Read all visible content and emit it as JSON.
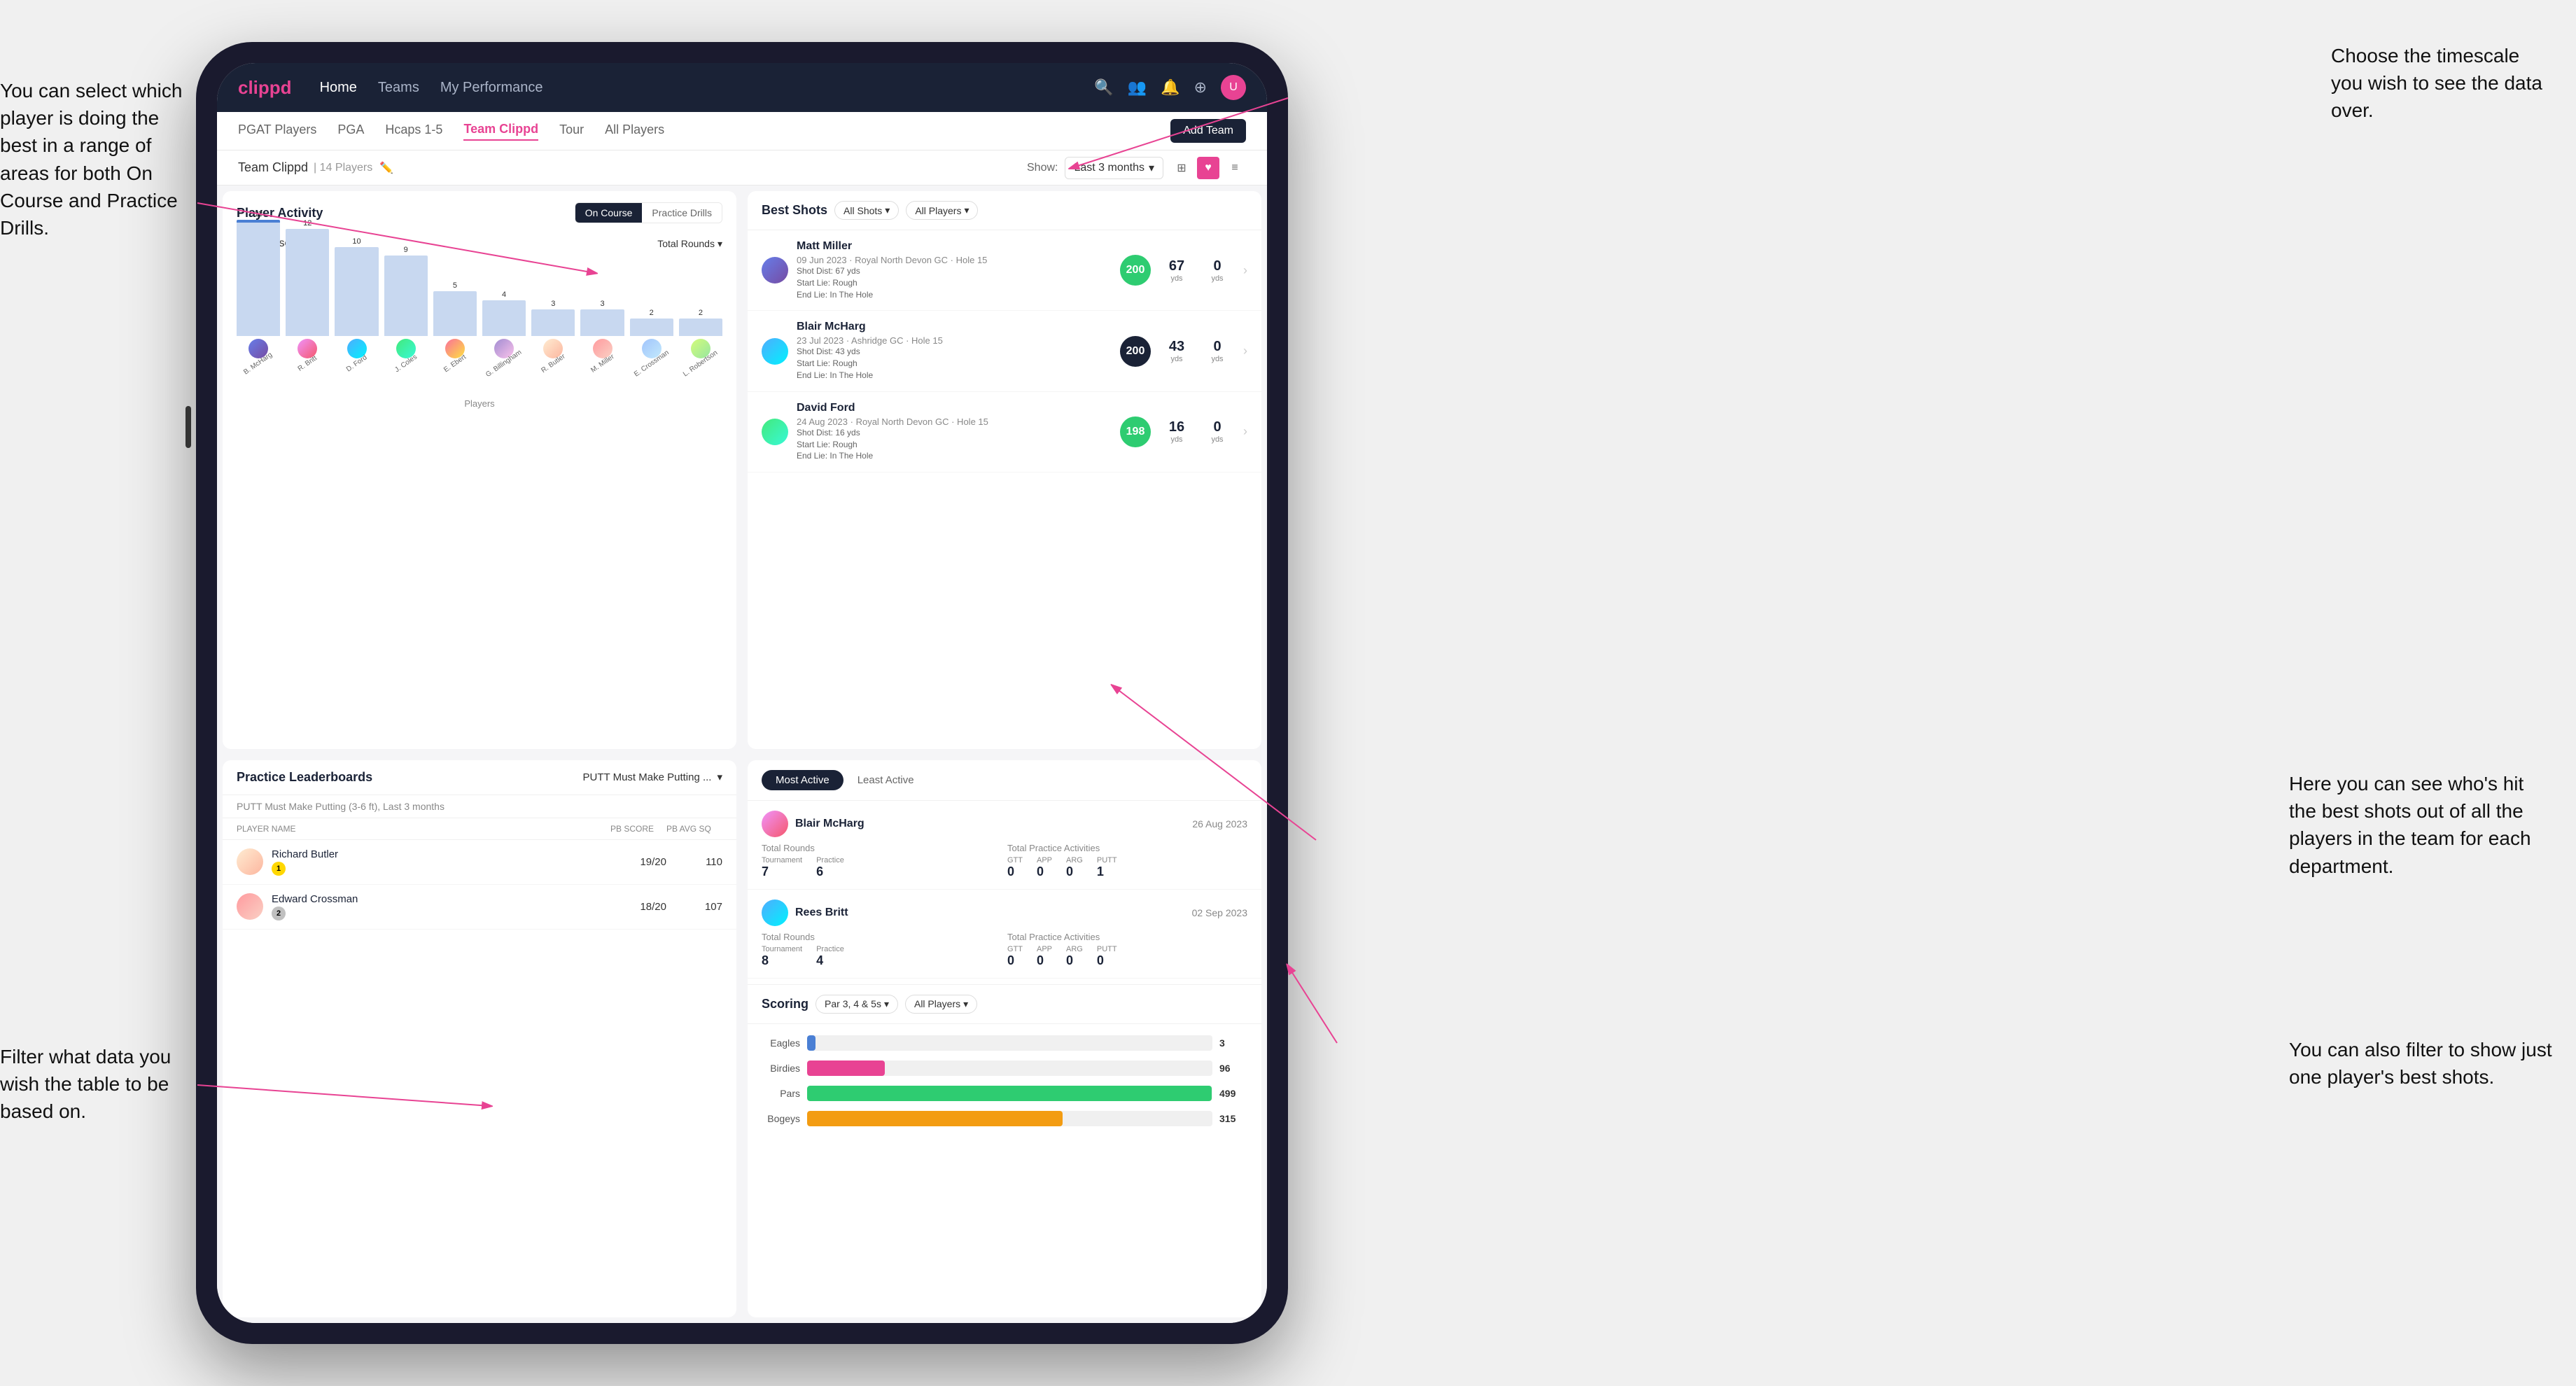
{
  "annotations": {
    "top_right": {
      "text": "Choose the timescale you wish to see the data over."
    },
    "top_left": {
      "text": "You can select which player is doing the best in a range of areas for both On Course and Practice Drills."
    },
    "bottom_left": {
      "text": "Filter what data you wish the table to be based on."
    },
    "bottom_right": {
      "text1": "Here you can see who's hit the best shots out of all the players in the team for each department.",
      "text2": "You can also filter to show just one player's best shots."
    }
  },
  "nav": {
    "logo": "clippd",
    "links": [
      "Home",
      "Teams",
      "My Performance"
    ],
    "active": "Teams"
  },
  "sub_nav": {
    "links": [
      "PGAT Players",
      "PGA",
      "Hcaps 1-5",
      "Team Clippd",
      "Tour",
      "All Players"
    ],
    "active": "Team Clippd",
    "add_button": "Add Team"
  },
  "team_header": {
    "name": "Team Clippd",
    "count": "14 Players",
    "show_label": "Show:",
    "time_filter": "Last 3 months"
  },
  "player_activity": {
    "title": "Player Activity",
    "toggle": [
      "On Course",
      "Practice Drills"
    ],
    "active_toggle": "On Course",
    "chart_label": "On Course",
    "chart_dropdown": "Total Rounds",
    "x_axis_label": "Players",
    "y_axis_label": "Total Rounds",
    "bars": [
      {
        "label": "13",
        "height": 195,
        "name": "B. McHarg",
        "highlight": true
      },
      {
        "label": "12",
        "height": 180,
        "name": "R. Britt",
        "highlight": false
      },
      {
        "label": "10",
        "height": 150,
        "name": "D. Ford",
        "highlight": false
      },
      {
        "label": "9",
        "height": 135,
        "name": "J. Coles",
        "highlight": false
      },
      {
        "label": "5",
        "height": 75,
        "name": "E. Ebert",
        "highlight": false
      },
      {
        "label": "4",
        "height": 60,
        "name": "G. Billingham",
        "highlight": false
      },
      {
        "label": "3",
        "height": 45,
        "name": "R. Butler",
        "highlight": false
      },
      {
        "label": "3",
        "height": 45,
        "name": "M. Miller",
        "highlight": false
      },
      {
        "label": "2",
        "height": 30,
        "name": "E. Crossman",
        "highlight": false
      },
      {
        "label": "2",
        "height": 30,
        "name": "L. Robertson",
        "highlight": false
      }
    ]
  },
  "best_shots": {
    "title": "Best Shots",
    "filter1": "All Shots",
    "filter2": "All Players",
    "players": [
      {
        "name": "Matt Miller",
        "date": "09 Jun 2023",
        "course": "Royal North Devon GC",
        "hole": "Hole 15",
        "badge_num": "200",
        "badge_class": "green",
        "shot_dist": "Shot Dist: 67 yds",
        "start_lie": "Start Lie: Rough",
        "end_lie": "End Lie: In The Hole",
        "dist_val": "67",
        "dist_unit": "yds",
        "carry_val": "0",
        "carry_unit": "yds"
      },
      {
        "name": "Blair McHarg",
        "date": "23 Jul 2023",
        "course": "Ashridge GC",
        "hole": "Hole 15",
        "badge_num": "200",
        "badge_class": "dark",
        "shot_dist": "Shot Dist: 43 yds",
        "start_lie": "Start Lie: Rough",
        "end_lie": "End Lie: In The Hole",
        "dist_val": "43",
        "dist_unit": "yds",
        "carry_val": "0",
        "carry_unit": "yds"
      },
      {
        "name": "David Ford",
        "date": "24 Aug 2023",
        "course": "Royal North Devon GC",
        "hole": "Hole 15",
        "badge_num": "198",
        "badge_class": "green",
        "shot_dist": "Shot Dist: 16 yds",
        "start_lie": "Start Lie: Rough",
        "end_lie": "End Lie: In The Hole",
        "dist_val": "16",
        "dist_unit": "yds",
        "carry_val": "0",
        "carry_unit": "yds"
      }
    ]
  },
  "practice_leaderboards": {
    "title": "Practice Leaderboards",
    "filter": "PUTT Must Make Putting ...",
    "subtitle": "PUTT Must Make Putting (3-6 ft), Last 3 months",
    "columns": [
      "PLAYER NAME",
      "PB SCORE",
      "PB AVG SQ"
    ],
    "players": [
      {
        "rank": "1",
        "name": "Richard Butler",
        "pb_score": "19/20",
        "pb_avg": "110"
      },
      {
        "rank": "2",
        "name": "Edward Crossman",
        "pb_score": "18/20",
        "pb_avg": "107"
      }
    ]
  },
  "most_active": {
    "tabs": [
      "Most Active",
      "Least Active"
    ],
    "active_tab": "Most Active",
    "players": [
      {
        "name": "Blair McHarg",
        "date": "26 Aug 2023",
        "total_rounds_label": "Total Rounds",
        "tournament_label": "Tournament",
        "practice_label": "Practice",
        "tournament_val": "7",
        "practice_val": "6",
        "total_practice_label": "Total Practice Activities",
        "gtt_label": "GTT",
        "app_label": "APP",
        "arg_label": "ARG",
        "putt_label": "PUTT",
        "gtt_val": "0",
        "app_val": "0",
        "arg_val": "0",
        "putt_val": "1"
      },
      {
        "name": "Rees Britt",
        "date": "02 Sep 2023",
        "tournament_val": "8",
        "practice_val": "4",
        "gtt_val": "0",
        "app_val": "0",
        "arg_val": "0",
        "putt_val": "0"
      }
    ]
  },
  "scoring": {
    "title": "Scoring",
    "filter1": "Par 3, 4 & 5s",
    "filter2": "All Players",
    "bars": [
      {
        "label": "Eagles",
        "value": 3,
        "max": 500,
        "color": "#4a7fd4"
      },
      {
        "label": "Birdies",
        "value": 96,
        "max": 500,
        "color": "#e84393"
      },
      {
        "label": "Pars",
        "value": 499,
        "max": 500,
        "color": "#2ecc71"
      },
      {
        "label": "Bogeys",
        "value": 315,
        "max": 500,
        "color": "#f39c12"
      }
    ]
  }
}
